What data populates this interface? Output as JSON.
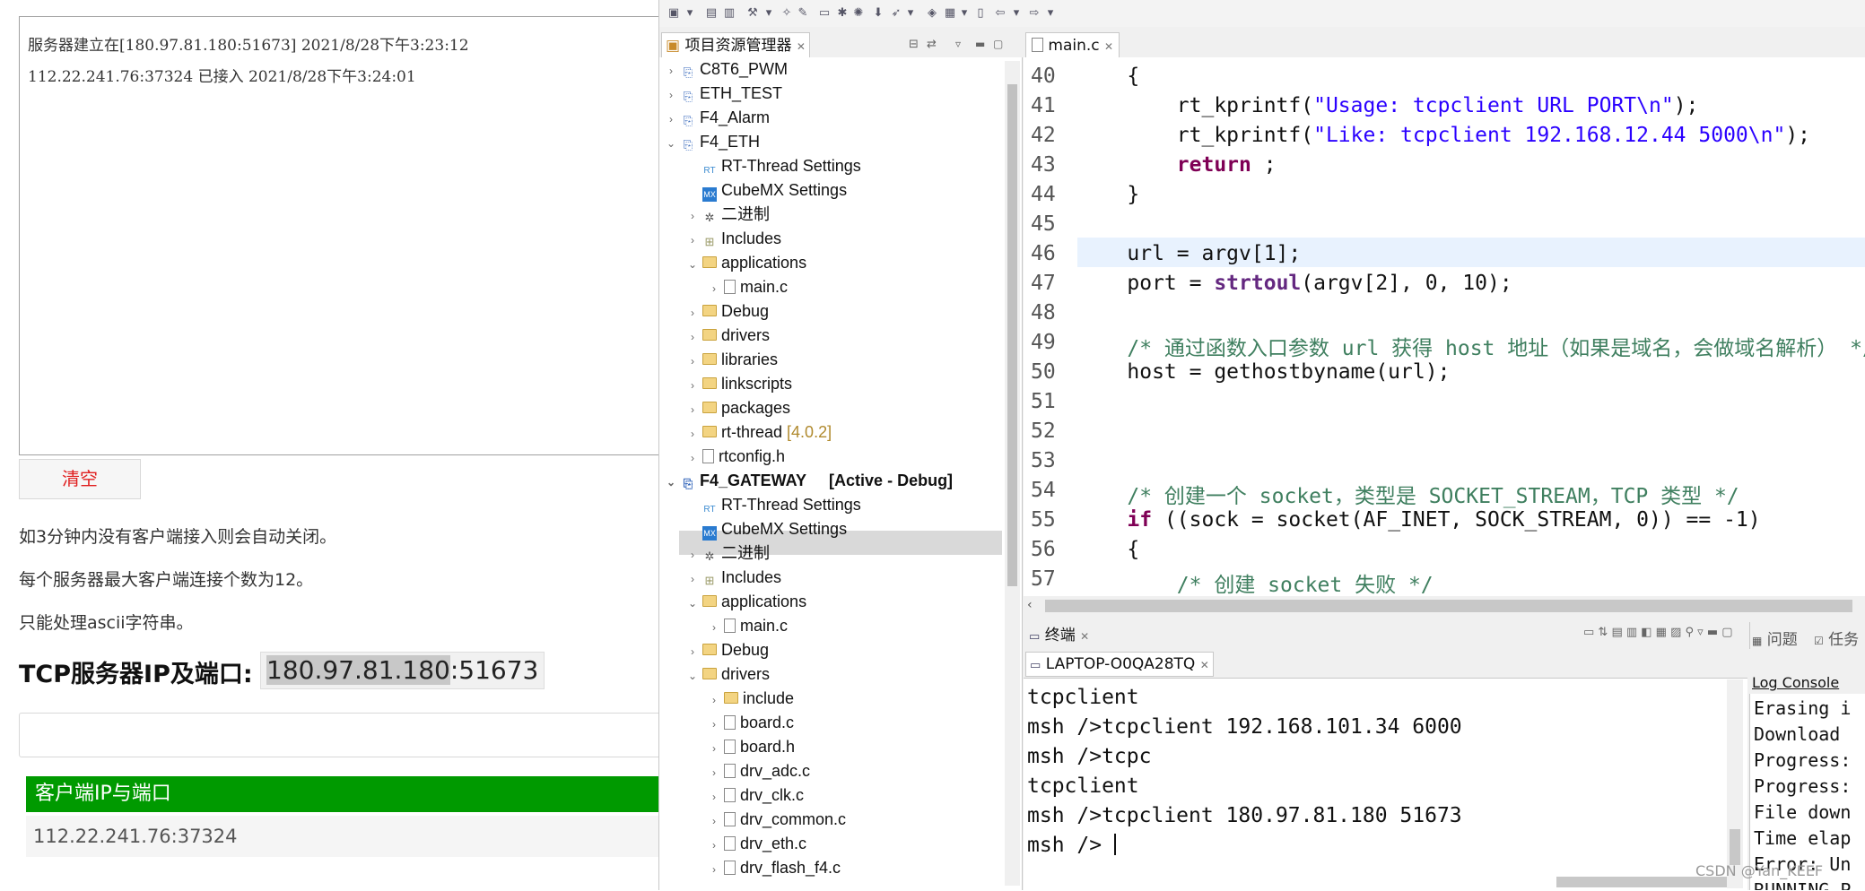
{
  "web": {
    "log_lines": [
      "服务器建立在[180.97.81.180:51673] 2021/8/28下午3:23:12",
      "112.22.241.76:37324 已接入 2021/8/28下午3:24:01"
    ],
    "clear_label": "清空",
    "notes": [
      "如3分钟内没有客户端接入则会自动关闭。",
      "每个服务器最大客户端连接个数为12。",
      "只能处理ascii字符串。"
    ],
    "ip_title": "TCP服务器IP及端口:",
    "ip_host": "180.97.81.180",
    "ip_port": ":51673",
    "clients_header": "客户端IP与端口",
    "clients": [
      "112.22.241.76:37324"
    ]
  },
  "ide": {
    "project_explorer_tab": "项目资源管理器",
    "editor_tab": "main.c",
    "terminal_tab": "终端",
    "terminal_session": "LAPTOP-O0QA28TQ",
    "problems_tab": "问题",
    "tasks_tab": "任务",
    "log_console_title": "Log Console",
    "tree": [
      {
        "label": "C8T6_PWM"
      },
      {
        "label": "ETH_TEST"
      },
      {
        "label": "F4_Alarm"
      },
      {
        "label": "F4_ETH"
      },
      {
        "label": "RT-Thread Settings"
      },
      {
        "label": "CubeMX Settings"
      },
      {
        "label": "二进制"
      },
      {
        "label": "Includes"
      },
      {
        "label": "applications"
      },
      {
        "label": "main.c"
      },
      {
        "label": "Debug"
      },
      {
        "label": "drivers"
      },
      {
        "label": "libraries"
      },
      {
        "label": "linkscripts"
      },
      {
        "label": "packages"
      },
      {
        "label": "rt-thread",
        "suffix": "[4.0.2]"
      },
      {
        "label": "rtconfig.h"
      },
      {
        "label": "F4_GATEWAY",
        "suffix": "[Active - Debug]"
      },
      {
        "label": "RT-Thread Settings"
      },
      {
        "label": "CubeMX Settings"
      },
      {
        "label": "二进制"
      },
      {
        "label": "Includes"
      },
      {
        "label": "applications"
      },
      {
        "label": "main.c"
      },
      {
        "label": "Debug"
      },
      {
        "label": "drivers"
      },
      {
        "label": "include"
      },
      {
        "label": "board.c"
      },
      {
        "label": "board.h"
      },
      {
        "label": "drv_adc.c"
      },
      {
        "label": "drv_clk.c"
      },
      {
        "label": "drv_common.c"
      },
      {
        "label": "drv_eth.c"
      },
      {
        "label": "drv_flash_f4.c"
      }
    ],
    "code_line_numbers": [
      "40",
      "41",
      "42",
      "43",
      "44",
      "45",
      "46",
      "47",
      "48",
      "49",
      "50",
      "51",
      "52",
      "53",
      "54",
      "55",
      "56",
      "57"
    ],
    "code": {
      "l40": "    {",
      "l41_a": "        rt_kprintf(",
      "l41_s": "\"Usage: tcpclient URL PORT\\n\"",
      "l41_b": ");",
      "l42_a": "        rt_kprintf(",
      "l42_s": "\"Like: tcpclient 192.168.12.44 5000\\n\"",
      "l42_b": ");",
      "l43_k": "        return",
      "l43_b": " ;",
      "l44": "    }",
      "l46": "    url = argv[1];",
      "l47_a": "    port = ",
      "l47_f": "strtoul",
      "l47_b": "(argv[2], 0, 10);",
      "l49": "    /* 通过函数入口参数 url 获得 host 地址（如果是域名，会做域名解析） */",
      "l50": "    host = gethostbyname(url);",
      "l54": "    /* 创建一个 socket，类型是 SOCKET_STREAM，TCP 类型 */",
      "l55_k": "    if",
      "l55_b": " ((sock = socket(AF_INET, SOCK_STREAM, 0)) == -1)",
      "l56": "    {",
      "l57": "        /* 创建 socket 失败 */"
    },
    "terminal_lines": [
      "tcpclient",
      "msh />tcpclient 192.168.101.34 6000",
      "msh />tcpc",
      "tcpclient",
      "msh />tcpclient 180.97.81.180 51673",
      "msh />"
    ],
    "log_console_lines": [
      "Erasing i",
      "Download",
      "Progress:",
      "Progress:",
      "File down",
      "Time elap",
      "Error: Un",
      "RUNNING P"
    ],
    "watermark": "CSDN @Yan_KEEF"
  }
}
